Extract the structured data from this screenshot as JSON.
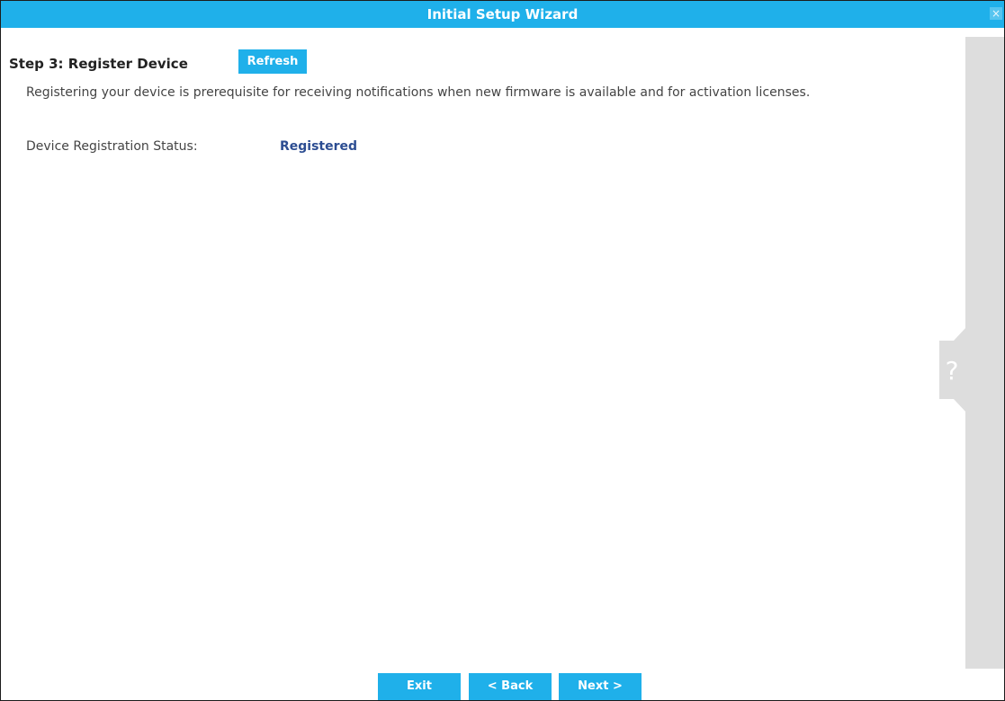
{
  "window": {
    "title": "Initial Setup Wizard",
    "close_label": "×"
  },
  "step": {
    "title": "Step 3: Register Device",
    "refresh_label": "Refresh",
    "description": "Registering your device is prerequisite for receiving notifications when new firmware is available and for activation licenses.",
    "status_label": "Device Registration Status:",
    "status_value": "Registered"
  },
  "help": {
    "icon_name": "help-icon",
    "glyph": "?"
  },
  "footer": {
    "exit_label": "Exit",
    "back_label": "< Back",
    "next_label": "Next >"
  },
  "colors": {
    "accent": "#1fb0ea",
    "status": "#2c4d92",
    "side_panel": "#dddddd"
  }
}
